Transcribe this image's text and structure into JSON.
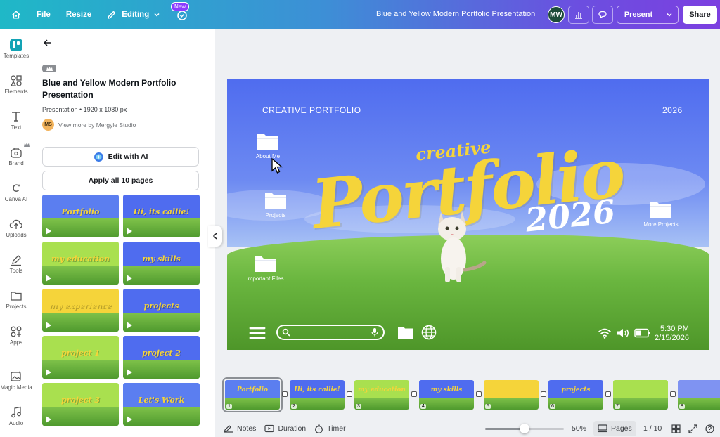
{
  "topbar": {
    "file": "File",
    "resize": "Resize",
    "editing": "Editing",
    "new_badge": "New",
    "doc_title": "Blue and Yellow Modern Portfolio Presentation",
    "avatar": "MW",
    "present": "Present",
    "share": "Share"
  },
  "rail": [
    {
      "label": "Templates"
    },
    {
      "label": "Elements"
    },
    {
      "label": "Text"
    },
    {
      "label": "Brand"
    },
    {
      "label": "Canva AI"
    },
    {
      "label": "Uploads"
    },
    {
      "label": "Tools"
    },
    {
      "label": "Projects"
    },
    {
      "label": "Apps"
    },
    {
      "label": "Magic Media"
    },
    {
      "label": "Audio"
    }
  ],
  "panel": {
    "title": "Blue and Yellow Modern Portfolio Presentation",
    "meta": "Presentation • 1920 x 1080 px",
    "author_initials": "MS",
    "author_text": "View more by Mergyle Studio",
    "edit_ai": "Edit with AI",
    "apply_all": "Apply all 10 pages",
    "thumbs": [
      {
        "text": "Portfolio",
        "sky": "#5b7ef0"
      },
      {
        "text": "Hi, its callie!",
        "sky": "#4f6cef"
      },
      {
        "text": "my education",
        "sky": "#a9e04f"
      },
      {
        "text": "my skills",
        "sky": "#4f6cef"
      },
      {
        "text": "my experience",
        "sky": "#f5d43a"
      },
      {
        "text": "projects",
        "sky": "#4f6cef"
      },
      {
        "text": "project 1",
        "sky": "#a9e04f"
      },
      {
        "text": "project 2",
        "sky": "#4f6cef"
      },
      {
        "text": "project 3",
        "sky": "#a9e04f"
      },
      {
        "text": "Let's Work",
        "sky": "#5b7ef0"
      }
    ]
  },
  "slide": {
    "header_left": "CREATIVE PORTFOLIO",
    "header_right": "2026",
    "creative": "creative",
    "portfolio": "Portfolio",
    "year": "2026",
    "folders": {
      "about": "About Me",
      "projects": "Projects",
      "important": "Important Files",
      "more": "More Projects"
    },
    "time": "5:30 PM",
    "date": "2/15/2026"
  },
  "strip": [
    {
      "num": "1",
      "text": "Portfolio",
      "sky": "#5b7ef0"
    },
    {
      "num": "2",
      "text": "Hi, its callie!",
      "sky": "#4f6cef"
    },
    {
      "num": "3",
      "text": "my education",
      "sky": "#a9e04f"
    },
    {
      "num": "4",
      "text": "my skills",
      "sky": "#4f6cef"
    },
    {
      "num": "5",
      "text": "my experience",
      "sky": "#f5d43a"
    },
    {
      "num": "6",
      "text": "projects",
      "sky": "#4f6cef"
    },
    {
      "num": "7",
      "text": "",
      "sky": "#a9e04f"
    },
    {
      "num": "8",
      "text": "",
      "sky": "#7f93f2"
    }
  ],
  "bottombar": {
    "notes": "Notes",
    "duration": "Duration",
    "timer": "Timer",
    "zoom": "50%",
    "zoom_level": 0.5,
    "pages": "Pages",
    "page_count": "1 / 10"
  },
  "colors": {
    "accent": "#8b3dff",
    "slide_yellow": "#f5d43a",
    "slide_blue": "#4f6cef"
  }
}
